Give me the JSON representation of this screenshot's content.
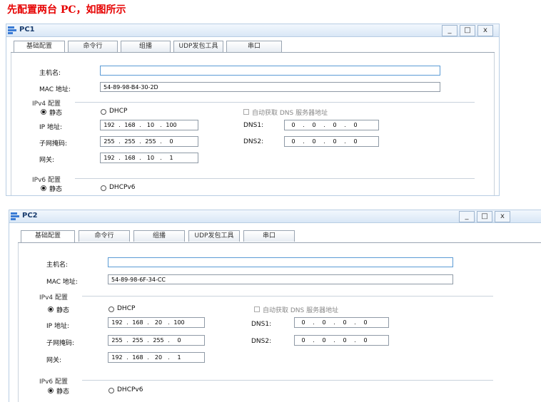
{
  "heading": "先配置两台 PC，如图所示",
  "tabs": [
    "基础配置",
    "命令行",
    "组播",
    "UDP发包工具",
    "串口"
  ],
  "window_controls": [
    "_",
    "□",
    "x"
  ],
  "labels": {
    "hostname": "主机名:",
    "mac": "MAC 地址:",
    "ipv4_section": "IPv4 配置",
    "static": "静态",
    "dhcp": "DHCP",
    "auto_dns": "自动获取 DNS 服务器地址",
    "ip": "IP 地址:",
    "mask": "子网掩码:",
    "gateway": "网关:",
    "dns1": "DNS1:",
    "dns2": "DNS2:",
    "ipv6_section": "IPv6 配置",
    "static6": "静态",
    "dhcpv6": "DHCPv6"
  },
  "pc1": {
    "title": "PC1",
    "hostname": "",
    "mac": "54-89-98-B4-30-2D",
    "ip": [
      "192",
      "168",
      "10",
      "100"
    ],
    "mask": [
      "255",
      "255",
      "255",
      "0"
    ],
    "gateway": [
      "192",
      "168",
      "10",
      "1"
    ],
    "dns1": [
      "0",
      "0",
      "0",
      "0"
    ],
    "dns2": [
      "0",
      "0",
      "0",
      "0"
    ]
  },
  "pc2": {
    "title": "PC2",
    "hostname": "",
    "mac": "54-89-98-6F-34-CC",
    "ip": [
      "192",
      "168",
      "20",
      "100"
    ],
    "mask": [
      "255",
      "255",
      "255",
      "0"
    ],
    "gateway": [
      "192",
      "168",
      "20",
      "1"
    ],
    "dns1": [
      "0",
      "0",
      "0",
      "0"
    ],
    "dns2": [
      "0",
      "0",
      "0",
      "0"
    ]
  }
}
